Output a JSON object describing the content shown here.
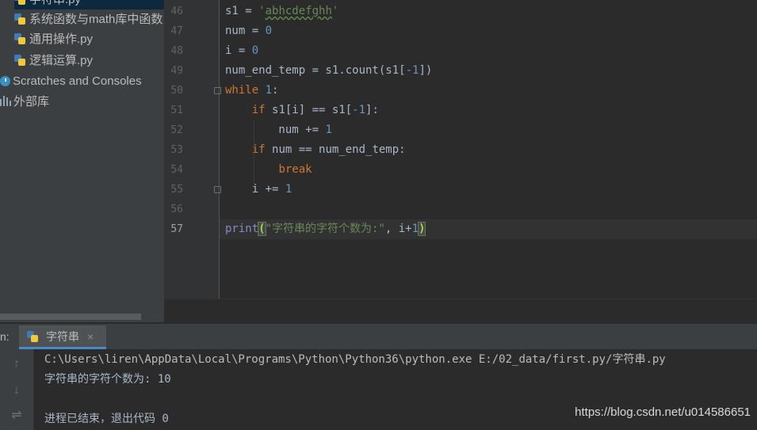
{
  "project_tree": {
    "items": [
      {
        "label": "字符串.py",
        "type": "python-file"
      },
      {
        "label": "系统函数与math库中函数",
        "type": "python-file"
      },
      {
        "label": "通用操作.py",
        "type": "python-file"
      },
      {
        "label": "逻辑运算.py",
        "type": "python-file"
      },
      {
        "label": "Scratches and Consoles",
        "type": "scratches"
      },
      {
        "label": "外部库",
        "type": "library"
      }
    ]
  },
  "editor": {
    "line_numbers": [
      "46",
      "47",
      "48",
      "49",
      "50",
      "51",
      "52",
      "53",
      "54",
      "55",
      "56",
      "57"
    ],
    "current_line": "57",
    "lines": [
      [
        {
          "t": "s1 = ",
          "c": ""
        },
        {
          "t": "'",
          "c": "str"
        },
        {
          "t": "abhcdefghh",
          "c": "str typo"
        },
        {
          "t": "'",
          "c": "str"
        }
      ],
      [
        {
          "t": "num = ",
          "c": ""
        },
        {
          "t": "0",
          "c": "num"
        }
      ],
      [
        {
          "t": "i = ",
          "c": ""
        },
        {
          "t": "0",
          "c": "num"
        }
      ],
      [
        {
          "t": "num_end_temp = s1.count(s1[",
          "c": ""
        },
        {
          "t": "-1",
          "c": "num"
        },
        {
          "t": "])",
          "c": ""
        }
      ],
      [
        {
          "t": "while ",
          "c": "kw"
        },
        {
          "t": "1",
          "c": "num"
        },
        {
          "t": ":",
          "c": ""
        }
      ],
      [
        {
          "t": "    ",
          "c": ""
        },
        {
          "t": "if ",
          "c": "kw"
        },
        {
          "t": "s1[i] == s1[",
          "c": ""
        },
        {
          "t": "-1",
          "c": "num"
        },
        {
          "t": "]:",
          "c": ""
        }
      ],
      [
        {
          "t": "        num += ",
          "c": ""
        },
        {
          "t": "1",
          "c": "num"
        }
      ],
      [
        {
          "t": "    ",
          "c": ""
        },
        {
          "t": "if ",
          "c": "kw"
        },
        {
          "t": "num == num_end_temp:",
          "c": ""
        }
      ],
      [
        {
          "t": "        ",
          "c": ""
        },
        {
          "t": "break",
          "c": "kw"
        }
      ],
      [
        {
          "t": "    i += ",
          "c": ""
        },
        {
          "t": "1",
          "c": "num"
        }
      ],
      [],
      [
        {
          "t": "print",
          "c": "fn"
        },
        {
          "t": "(",
          "c": "brace"
        },
        {
          "t": "\"字符串的字符个数为:\"",
          "c": "str"
        },
        {
          "t": ", i+",
          "c": ""
        },
        {
          "t": "1",
          "c": "num"
        },
        {
          "t": ")",
          "c": "brace"
        }
      ]
    ]
  },
  "run_panel": {
    "label": "n:",
    "tab_label": "字符串",
    "tab_close": "×",
    "toolbar": {
      "up_icon": "↑",
      "down_icon": "↓",
      "wrap_icon": "⇌"
    },
    "console": {
      "command": "C:\\Users\\liren\\AppData\\Local\\Programs\\Python\\Python36\\python.exe E:/02_data/first.py/字符串.py",
      "output": "字符串的字符个数为: 10",
      "blank": "",
      "exit": "进程已结束，退出代码 0"
    }
  },
  "watermark": "https://blog.csdn.net/u014586651"
}
